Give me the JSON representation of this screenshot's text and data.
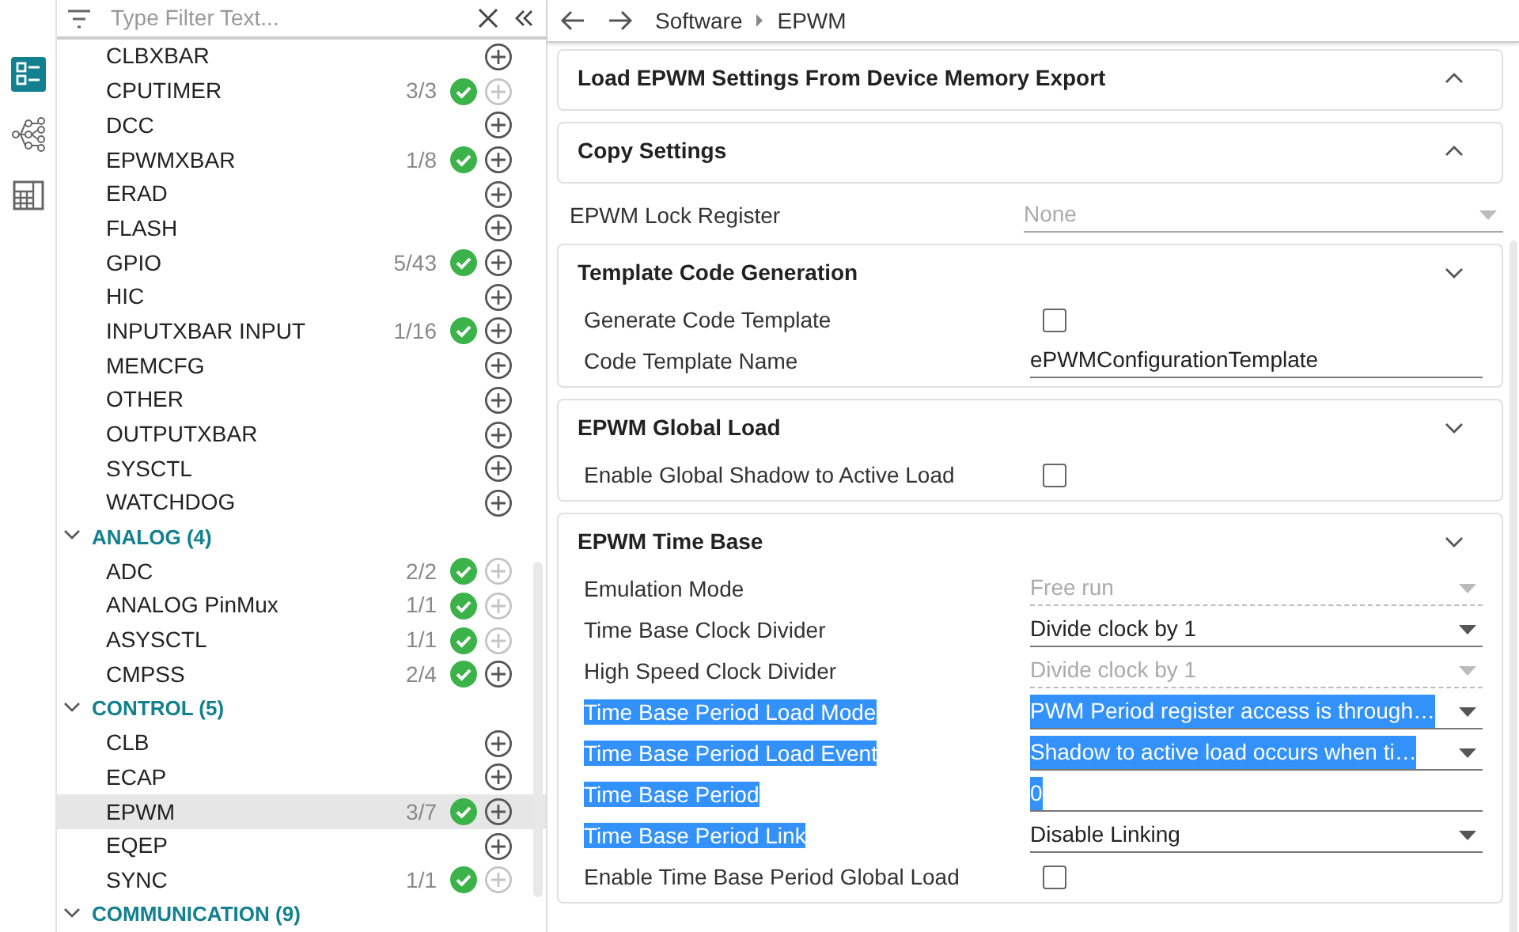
{
  "activity_bar": [
    {
      "kind": "list",
      "selected": true
    },
    {
      "kind": "tree",
      "selected": false
    },
    {
      "kind": "calculator",
      "selected": false
    }
  ],
  "filter": {
    "placeholder": "Type Filter Text..."
  },
  "tree": [
    {
      "kind": "item",
      "label": "CLBXBAR",
      "configured": false,
      "add_disabled": false,
      "selected": false
    },
    {
      "kind": "item",
      "label": "CPUTIMER",
      "count": "3/3",
      "configured": true,
      "add_disabled": true,
      "selected": false
    },
    {
      "kind": "item",
      "label": "DCC",
      "configured": false,
      "add_disabled": false,
      "selected": false
    },
    {
      "kind": "item",
      "label": "EPWMXBAR",
      "count": "1/8",
      "configured": true,
      "add_disabled": false,
      "selected": false
    },
    {
      "kind": "item",
      "label": "ERAD",
      "configured": false,
      "add_disabled": false,
      "selected": false
    },
    {
      "kind": "item",
      "label": "FLASH",
      "configured": false,
      "add_disabled": false,
      "selected": false
    },
    {
      "kind": "item",
      "label": "GPIO",
      "count": "5/43",
      "configured": true,
      "add_disabled": false,
      "selected": false
    },
    {
      "kind": "item",
      "label": "HIC",
      "configured": false,
      "add_disabled": false,
      "selected": false
    },
    {
      "kind": "item",
      "label": "INPUTXBAR INPUT",
      "count": "1/16",
      "configured": true,
      "add_disabled": false,
      "selected": false
    },
    {
      "kind": "item",
      "label": "MEMCFG",
      "configured": false,
      "add_disabled": false,
      "selected": false
    },
    {
      "kind": "item",
      "label": "OTHER",
      "configured": false,
      "add_disabled": false,
      "selected": false
    },
    {
      "kind": "item",
      "label": "OUTPUTXBAR",
      "configured": false,
      "add_disabled": false,
      "selected": false
    },
    {
      "kind": "item",
      "label": "SYSCTL",
      "configured": false,
      "add_disabled": false,
      "selected": false
    },
    {
      "kind": "item",
      "label": "WATCHDOG",
      "configured": false,
      "add_disabled": false,
      "selected": false
    },
    {
      "kind": "group",
      "label": "ANALOG (4)",
      "expanded": true,
      "children": [
        {
          "kind": "item",
          "label": "ADC",
          "count": "2/2",
          "configured": true,
          "add_disabled": true,
          "selected": false
        },
        {
          "kind": "item",
          "label": "ANALOG PinMux",
          "count": "1/1",
          "configured": true,
          "add_disabled": true,
          "selected": false
        },
        {
          "kind": "item",
          "label": "ASYSCTL",
          "count": "1/1",
          "configured": true,
          "add_disabled": true,
          "selected": false
        },
        {
          "kind": "item",
          "label": "CMPSS",
          "count": "2/4",
          "configured": true,
          "add_disabled": false,
          "selected": false
        }
      ]
    },
    {
      "kind": "group",
      "label": "CONTROL (5)",
      "expanded": true,
      "children": [
        {
          "kind": "item",
          "label": "CLB",
          "configured": false,
          "add_disabled": false,
          "selected": false
        },
        {
          "kind": "item",
          "label": "ECAP",
          "configured": false,
          "add_disabled": false,
          "selected": false
        },
        {
          "kind": "item",
          "label": "EPWM",
          "count": "3/7",
          "configured": true,
          "add_disabled": false,
          "selected": true
        },
        {
          "kind": "item",
          "label": "EQEP",
          "configured": false,
          "add_disabled": false,
          "selected": false
        },
        {
          "kind": "item",
          "label": "SYNC",
          "count": "1/1",
          "configured": true,
          "add_disabled": true,
          "selected": false
        }
      ]
    },
    {
      "kind": "group",
      "label": "COMMUNICATION (9)",
      "expanded": true
    }
  ],
  "breadcrumb": [
    "Software",
    "EPWM"
  ],
  "content": [
    {
      "kind": "section",
      "title": "Load EPWM Settings From Device Memory Export",
      "expanded": false
    },
    {
      "kind": "section",
      "title": "Copy Settings",
      "expanded": false
    },
    {
      "kind": "select",
      "label": "EPWM Lock Register",
      "value": "None",
      "disabled": true
    },
    {
      "kind": "section",
      "title": "Template Code Generation",
      "expanded": true,
      "rows": [
        {
          "kind": "checkbox",
          "label": "Generate Code Template",
          "checked": false
        },
        {
          "kind": "text",
          "label": "Code Template Name",
          "value": "ePWMConfigurationTemplate"
        }
      ]
    },
    {
      "kind": "section",
      "title": "EPWM Global Load",
      "expanded": true,
      "rows": [
        {
          "kind": "checkbox",
          "label": "Enable Global Shadow to Active Load",
          "checked": false
        }
      ]
    },
    {
      "kind": "section",
      "title": "EPWM Time Base",
      "expanded": true,
      "rows": [
        {
          "kind": "select",
          "label": "Emulation Mode",
          "value": "Free run",
          "disabled": true
        },
        {
          "kind": "select",
          "label": "Time Base Clock Divider",
          "value": "Divide clock by 1",
          "disabled": false
        },
        {
          "kind": "select",
          "label": "High Speed Clock Divider",
          "value": "Divide clock by 1",
          "disabled": true
        },
        {
          "kind": "select",
          "label": "Time Base Period Load Mode",
          "value": "PWM Period register access is through…",
          "disabled": false,
          "highlighted": true
        },
        {
          "kind": "select",
          "label": "Time Base Period Load Event",
          "value": "Shadow to active load occurs when ti…",
          "disabled": false,
          "highlighted": true
        },
        {
          "kind": "text",
          "label": "Time Base Period",
          "value": "0",
          "highlighted": true
        },
        {
          "kind": "select",
          "label": "Time Base Period Link",
          "value": "Disable Linking",
          "disabled": false,
          "label_highlighted": true
        },
        {
          "kind": "checkbox",
          "label": "Enable Time Base Period Global Load",
          "checked": false
        }
      ]
    }
  ]
}
